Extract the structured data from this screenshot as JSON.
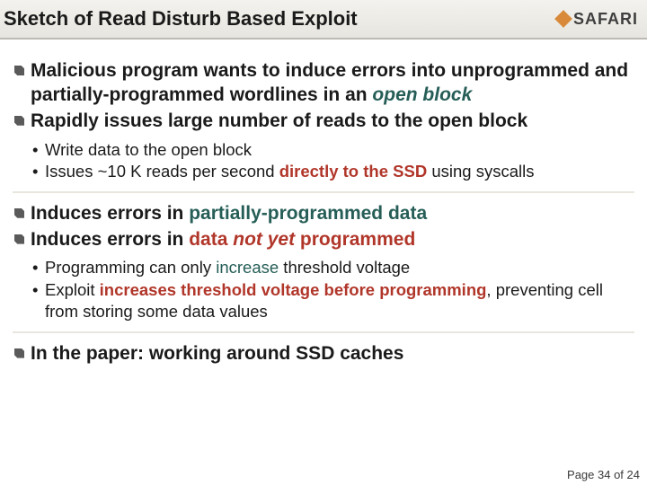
{
  "header": {
    "title": "Sketch of Read Disturb Based Exploit",
    "logo_text": "SAFARI"
  },
  "bullets": {
    "b1_pre": "Malicious program wants to induce errors into unprogrammed and partially-programmed wordlines in an ",
    "b1_em": "open block",
    "b2": "Rapidly issues large number of reads to the open block",
    "sub1_1": "Write data to the open block",
    "sub1_2a": "Issues ~10 K reads per second ",
    "sub1_2b": "directly to the SSD",
    "sub1_2c": " using syscalls",
    "b3a": "Induces errors in ",
    "b3b": "partially-programmed data",
    "b4a": "Induces errors in ",
    "b4b": "data ",
    "b4c": "not yet",
    "b4d": " programmed",
    "sub2_1a": "Programming can only ",
    "sub2_1b": "increase",
    "sub2_1c": " threshold voltage",
    "sub2_2a": "Exploit ",
    "sub2_2b": "increases threshold voltage before programming",
    "sub2_2c": ", preventing cell from storing some data values",
    "b5": "In the paper: working around SSD caches"
  },
  "footer": {
    "page_text": "Page 34 of 24"
  }
}
